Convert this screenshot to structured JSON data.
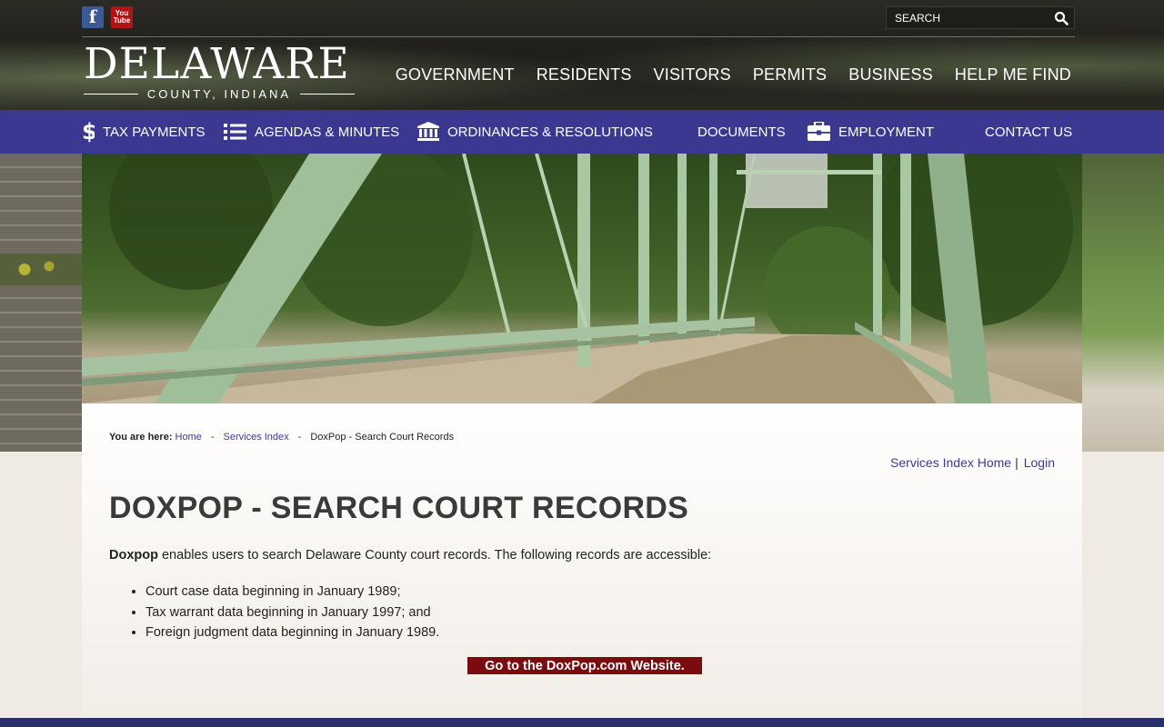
{
  "social": {
    "facebook_label": "f",
    "youtube_top": "You",
    "youtube_bottom": "Tube"
  },
  "search": {
    "placeholder": "SEARCH"
  },
  "logo": {
    "main": "DELAWARE",
    "sub": "COUNTY, INDIANA"
  },
  "main_nav": [
    "GOVERNMENT",
    "RESIDENTS",
    "VISITORS",
    "PERMITS",
    "BUSINESS",
    "HELP ME FIND"
  ],
  "sub_nav": [
    {
      "label": "TAX PAYMENTS",
      "icon": "dollar-icon"
    },
    {
      "label": "AGENDAS & MINUTES",
      "icon": "list-icon"
    },
    {
      "label": "ORDINANCES & RESOLUTIONS",
      "icon": "bank-icon"
    },
    {
      "label": "DOCUMENTS",
      "icon": ""
    },
    {
      "label": "EMPLOYMENT",
      "icon": "briefcase-icon"
    },
    {
      "label": "CONTACT US",
      "icon": ""
    }
  ],
  "breadcrumb": {
    "label": "You are here:",
    "home": "Home",
    "sep": "-",
    "services": "Services Index",
    "current": "DoxPop - Search Court Records"
  },
  "toplinks": {
    "services_home": "Services Index Home",
    "bar": "|",
    "login": "Login"
  },
  "page": {
    "title": "DOXPOP - SEARCH COURT RECORDS",
    "intro_bold": "Doxpop",
    "intro_rest": " enables users to search Delaware County court records.  The following records are accessible:",
    "records": [
      "Court case data beginning in January 1989;",
      "Tax warrant data beginning in January 1997; and",
      "Foreign judgment data beginning in January 1989."
    ],
    "cta": "Go to the DoxPop.com Website."
  },
  "colors": {
    "nav_bar": "#3b3892",
    "link": "#3a3b8f",
    "cta_bg": "#7a0c10",
    "header_bg": "#1e1d1a"
  }
}
